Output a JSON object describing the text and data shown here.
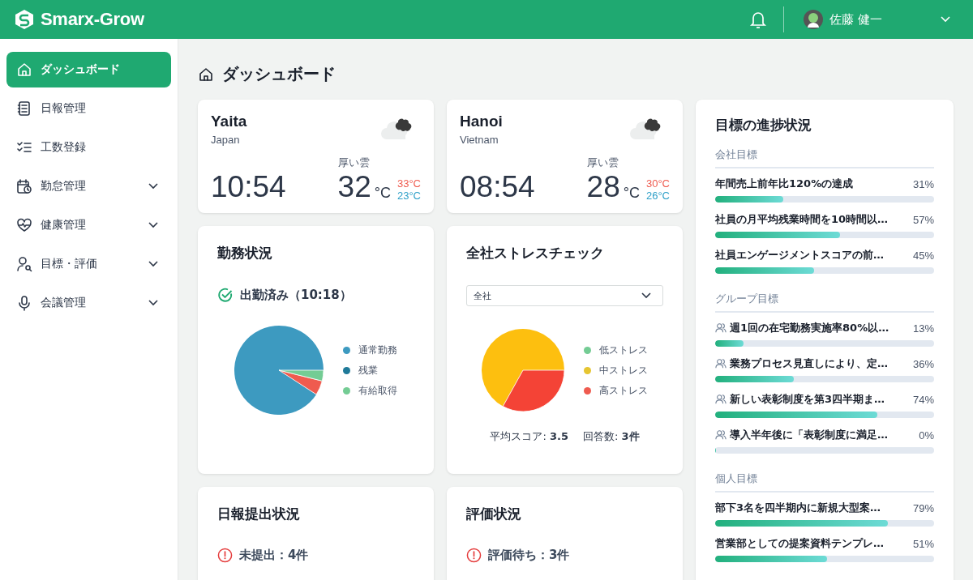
{
  "header": {
    "logo": "Smarx-Grow",
    "user_name": "佐藤 健一"
  },
  "sidebar": {
    "items": [
      {
        "label": "ダッシュボード",
        "selected": true,
        "expandable": false
      },
      {
        "label": "日報管理",
        "selected": false,
        "expandable": false
      },
      {
        "label": "工数登録",
        "selected": false,
        "expandable": false
      },
      {
        "label": "勤怠管理",
        "selected": false,
        "expandable": true
      },
      {
        "label": "健康管理",
        "selected": false,
        "expandable": true
      },
      {
        "label": "目標・評価",
        "selected": false,
        "expandable": true
      },
      {
        "label": "会議管理",
        "selected": false,
        "expandable": true
      }
    ]
  },
  "page_title": "ダッシュボード",
  "weather": [
    {
      "city": "Yaita",
      "country": "Japan",
      "condition": "厚い雲",
      "time": "10:54",
      "temp": "32",
      "unit": "°C",
      "high": "33°C",
      "low": "23°C"
    },
    {
      "city": "Hanoi",
      "country": "Vietnam",
      "condition": "厚い雲",
      "time": "08:54",
      "temp": "28",
      "unit": "°C",
      "high": "30°C",
      "low": "26°C"
    }
  ],
  "work_status": {
    "title": "勤務状況",
    "status": "出勤済み（10:18）",
    "legend": [
      {
        "label": "通常勤務",
        "color": "#3d9ac0"
      },
      {
        "label": "残業",
        "color": "#1f7a99"
      },
      {
        "label": "有給取得",
        "color": "#74cc94"
      }
    ]
  },
  "stress": {
    "title": "全社ストレスチェック",
    "filter": "全社",
    "legend": [
      {
        "label": "低ストレス",
        "color": "#74cc94"
      },
      {
        "label": "中ストレス",
        "color": "#e6c531"
      },
      {
        "label": "高ストレス",
        "color": "#ef5b4f"
      }
    ],
    "stats": [
      "平均スコア: **3.5**",
      "回答数: **3件**"
    ]
  },
  "daily_report": {
    "title": "日報提出状況",
    "alert": "未提出：4件"
  },
  "evaluation": {
    "title": "評価状況",
    "alert": "評価待ち：3件"
  },
  "goals": {
    "title": "目標の進捗状況",
    "sections": [
      {
        "label": "会社目標",
        "items": [
          {
            "kind": "plain",
            "title": "年間売上前年比120%の達成",
            "percent": "31%",
            "level": 0.31
          },
          {
            "kind": "plain",
            "title": "社員の月平均残業時間を10時間以…",
            "percent": "57%",
            "level": 0.57
          },
          {
            "kind": "plain",
            "title": "社員エンゲージメントスコアの前…",
            "percent": "45%",
            "level": 0.45
          }
        ]
      },
      {
        "label": "グループ目標",
        "items": [
          {
            "kind": "team",
            "title": "週1回の在宅勤務実施率80%以…",
            "percent": "13%",
            "level": 0.13
          },
          {
            "kind": "team",
            "title": "業務プロセス見直しにより、定…",
            "percent": "36%",
            "level": 0.36
          },
          {
            "kind": "team",
            "title": "新しい表彰制度を第3四半期ま…",
            "percent": "74%",
            "level": 0.74
          },
          {
            "kind": "team",
            "title": "導入半年後に「表彰制度に満足…",
            "percent": "0%",
            "level": 0
          }
        ]
      },
      {
        "label": "個人目標",
        "items": [
          {
            "kind": "plain",
            "title": "部下3名を四半期内に新規大型案…",
            "percent": "79%",
            "level": 0.79
          },
          {
            "kind": "plain",
            "title": "営業部としての提案資料テンプレ…",
            "percent": "51%",
            "level": 0.51
          }
        ]
      }
    ]
  }
}
